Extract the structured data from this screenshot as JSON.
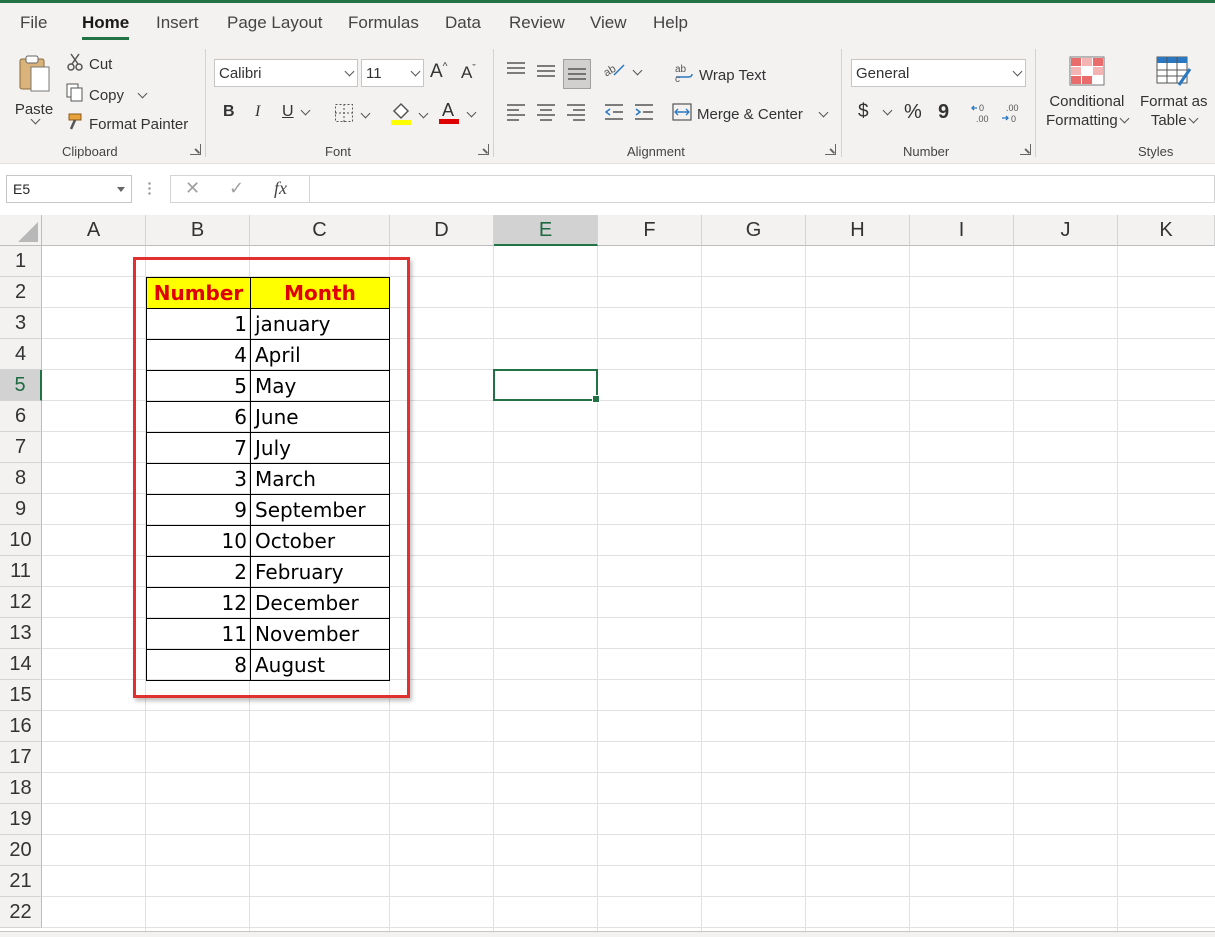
{
  "ribbon_tabs": [
    "File",
    "Home",
    "Insert",
    "Page Layout",
    "Formulas",
    "Data",
    "Review",
    "View",
    "Help"
  ],
  "active_tab": "Home",
  "clipboard": {
    "paste": "Paste",
    "cut": "Cut",
    "copy": "Copy",
    "format_painter": "Format Painter",
    "label": "Clipboard"
  },
  "font": {
    "name": "Calibri",
    "size": "11",
    "bold": "B",
    "italic": "I",
    "underline": "U",
    "label": "Font",
    "font_color": "#e00000",
    "fill_color": "#ffff00"
  },
  "alignment": {
    "wrap_text": "Wrap Text",
    "merge_center": "Merge & Center",
    "label": "Alignment"
  },
  "number": {
    "format": "General",
    "currency": "$",
    "percent": "%",
    "comma": "9",
    "label": "Number"
  },
  "styles": {
    "conditional_l1": "Conditional",
    "conditional_l2": "Formatting",
    "format_table_l1": "Format as",
    "format_table_l2": "Table",
    "label": "Styles"
  },
  "formula_bar": {
    "name_box": "E5",
    "fx": "fx",
    "formula": ""
  },
  "columns": [
    "A",
    "B",
    "C",
    "D",
    "E",
    "F",
    "G",
    "H",
    "I",
    "J",
    "K"
  ],
  "selected_column": "E",
  "rows": [
    "1",
    "2",
    "3",
    "4",
    "5",
    "6",
    "7",
    "8",
    "9",
    "10",
    "11",
    "12",
    "13",
    "14",
    "15",
    "16",
    "17",
    "18",
    "19",
    "20",
    "21",
    "22"
  ],
  "selected_row": "5",
  "table": {
    "headers": [
      "Number",
      "Month"
    ],
    "rows": [
      [
        "1",
        "january"
      ],
      [
        "4",
        "April"
      ],
      [
        "5",
        "May"
      ],
      [
        "6",
        "June"
      ],
      [
        "7",
        "July"
      ],
      [
        "3",
        "March"
      ],
      [
        "9",
        "September"
      ],
      [
        "10",
        "October"
      ],
      [
        "2",
        "February"
      ],
      [
        "12",
        "December"
      ],
      [
        "11",
        "November"
      ],
      [
        "8",
        "August"
      ]
    ]
  },
  "colors": {
    "accent": "#217346",
    "header_fill": "#ffff00",
    "header_text": "#e00000",
    "highlight_box": "#e03030"
  }
}
